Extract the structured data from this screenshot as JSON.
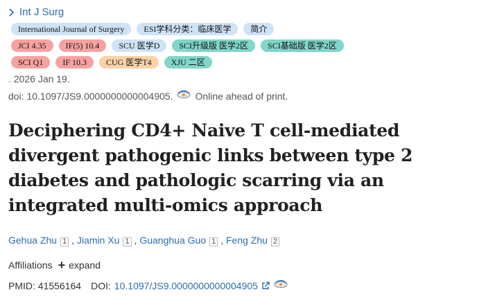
{
  "journal": {
    "link_label": "Int J Surg"
  },
  "badges": {
    "row1": [
      {
        "label": "International Journal of Surgery",
        "color": "blue"
      },
      {
        "label": "ESI学科分类：临床医学",
        "color": "blue"
      },
      {
        "label": "简介",
        "color": "blue"
      }
    ],
    "row2": [
      {
        "label": "JCI 4.35",
        "color": "red"
      },
      {
        "label": "IF(5) 10.4",
        "color": "red"
      },
      {
        "label": "SCU 医学D",
        "color": "blue"
      },
      {
        "label": "SCI升级版 医学2区",
        "color": "teal"
      },
      {
        "label": "SCI基础版 医学2区",
        "color": "teal"
      }
    ],
    "row3": [
      {
        "label": "SCI Q1",
        "color": "red"
      },
      {
        "label": "IF 10.3",
        "color": "red"
      },
      {
        "label": "CUG 医学T4",
        "color": "orange"
      },
      {
        "label": "XJU 二区",
        "color": "teal"
      }
    ]
  },
  "citation": {
    "date": ". 2026 Jan 19.",
    "doi": "doi: 10.1097/JS9.0000000000004905.",
    "status": "Online ahead of print."
  },
  "article": {
    "title": "Deciphering CD4+ Naive T cell-mediated divergent pathogenic links between type 2 diabetes and pathologic scarring via an integrated multi-omics approach"
  },
  "authors": [
    {
      "name": "Gehua Zhu",
      "aff": "1",
      "sep": ","
    },
    {
      "name": "Jiamin Xu",
      "aff": "1",
      "sep": ","
    },
    {
      "name": "Guanghua Guo",
      "aff": "1",
      "sep": ","
    },
    {
      "name": "Feng Zhu",
      "aff": "2",
      "sep": ""
    }
  ],
  "affiliations": {
    "label": "Affiliations",
    "expand_label": "expand"
  },
  "identifiers": {
    "pmid_label": "PMID:",
    "pmid": "41556164",
    "doi_label": "DOI:",
    "doi": "10.1097/JS9.0000000000004905"
  },
  "colors": {
    "link": "#2b6cb0",
    "badge_blue": "#cfe3f6",
    "badge_red": "#f7a1a1",
    "badge_teal": "#7fd6c9",
    "badge_orange": "#fbd2a8"
  }
}
